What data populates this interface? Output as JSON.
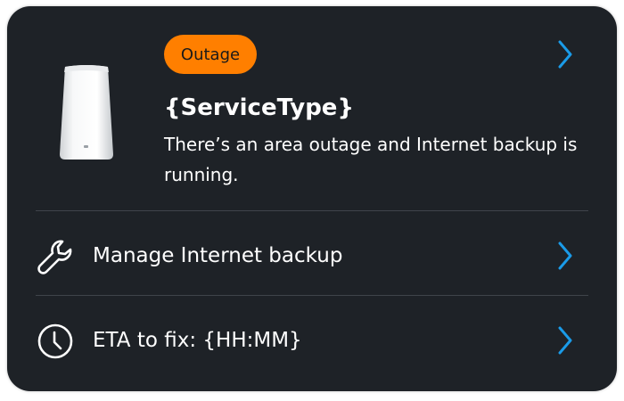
{
  "status": {
    "badge": "Outage",
    "service_type": "{ServiceType}",
    "description": "There’s an area outage and Internet backup is running."
  },
  "actions": [
    {
      "label": "Manage Internet backup",
      "icon": "wrench-icon"
    },
    {
      "label": "ETA to fix:  {HH:MM}",
      "icon": "clock-icon"
    }
  ],
  "colors": {
    "card_background": "#1e2227",
    "badge": "#ff7f00",
    "chevron": "#1a9be8",
    "divider": "#3f444b"
  },
  "icons": {
    "device": "router-device-icon",
    "chevron": "chevron-right-icon"
  }
}
